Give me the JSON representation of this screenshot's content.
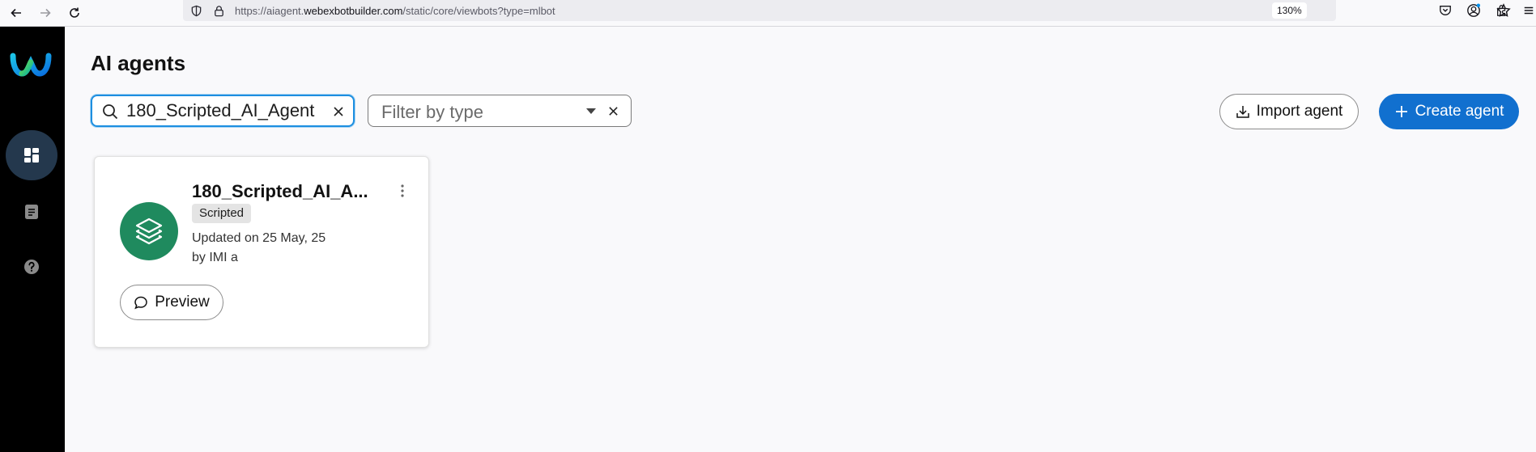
{
  "browser": {
    "url_prefix": "https://aiagent.",
    "url_host": "webexbotbuilder.com",
    "url_path": "/static/core/viewbots?type=mlbot",
    "zoom": "130%",
    "icons": [
      "back-icon",
      "forward-icon",
      "reload-icon",
      "shield-icon",
      "lock-icon",
      "star-icon",
      "pocket-icon",
      "account-icon",
      "extensions-icon",
      "menu-icon"
    ]
  },
  "sidebar": {
    "items": [
      {
        "name": "dashboard",
        "icon": "grid-icon",
        "active": true
      },
      {
        "name": "documents",
        "icon": "document-icon",
        "active": false
      },
      {
        "name": "help",
        "icon": "help-icon",
        "active": false
      }
    ]
  },
  "page": {
    "title": "AI agents"
  },
  "search": {
    "value": "180_Scripted_AI_Agent"
  },
  "filter": {
    "placeholder": "Filter by type"
  },
  "actions": {
    "import_label": "Import agent",
    "create_label": "Create agent"
  },
  "agents": [
    {
      "name": "180_Scripted_AI_A...",
      "type": "Scripted",
      "updated": "Updated on 25 May, 25",
      "by": "by IMI a",
      "preview_label": "Preview"
    }
  ],
  "colors": {
    "primary": "#1170cf",
    "sidebar_bg": "#000000",
    "sidebar_active": "#24384d",
    "avatar_bg": "#1f8a5e",
    "focus_border": "#1d8fe0"
  }
}
